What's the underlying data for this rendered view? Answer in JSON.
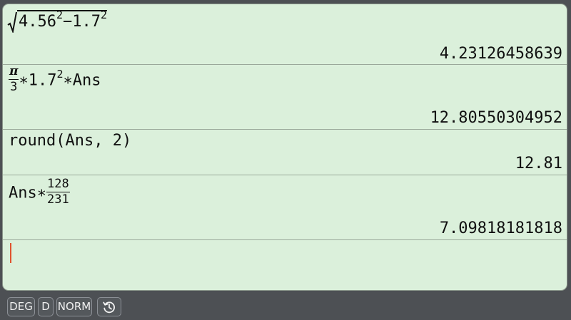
{
  "history": {
    "entries": [
      {
        "expression": {
          "sqrt_a": "4.56",
          "exp_a": "2",
          "minus": "−",
          "sqrt_b": "1.7",
          "exp_b": "2"
        },
        "result": "4.23126458639"
      },
      {
        "expression": {
          "frac_num": "π",
          "frac_den": "3",
          "mid": "∗1.7",
          "exp": "2",
          "tail": "∗Ans"
        },
        "result": "12.80550304952"
      },
      {
        "expression": {
          "text": "round(Ans, 2)"
        },
        "result": "12.81"
      },
      {
        "expression": {
          "prefix": "Ans∗",
          "frac_num": "128",
          "frac_den": "231"
        },
        "result": "7.09818181818"
      }
    ]
  },
  "status_bar": {
    "angle_mode": "DEG",
    "display_mode": "D",
    "number_format": "NORM",
    "history_icon": "history-icon"
  },
  "colors": {
    "screen_bg": "#dbf0db",
    "status_bg": "#4d5054",
    "cursor": "#e0532e"
  }
}
